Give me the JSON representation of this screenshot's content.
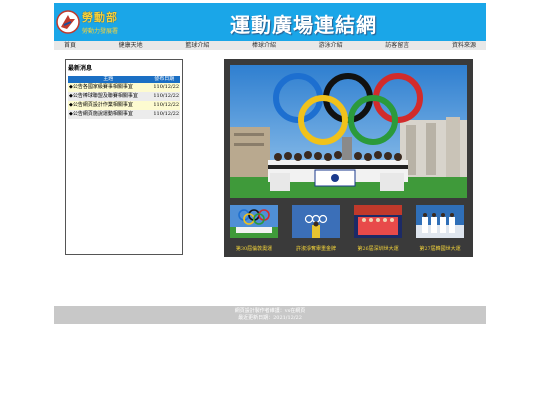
{
  "header": {
    "logo_text": "勞動部",
    "logo_sub": "勞動力發展署",
    "site_title": "運動廣場連結網"
  },
  "nav": {
    "items": [
      "首頁",
      "健康天地",
      "籃球介紹",
      "棒球介紹",
      "游泳介紹",
      "訪客留言",
      "資料來源"
    ]
  },
  "news": {
    "title": "最新消息",
    "col_subject": "主題",
    "col_date": "發布日期",
    "rows": [
      {
        "subject": "◆公告各國家級賽事相關事宜",
        "date": "110/12/22"
      },
      {
        "subject": "◆公告棒球聯盟及聯賽相關事宜",
        "date": "110/12/22"
      },
      {
        "subject": "◆公告網頁設計作業相關事宜",
        "date": "110/12/22"
      },
      {
        "subject": "◆公告網頁施說運動相關事宜",
        "date": "110/12/22"
      }
    ]
  },
  "gallery": {
    "thumbs": [
      {
        "caption": "第30屆倫敦奧運"
      },
      {
        "caption": "許淑淨奪舉重金牌"
      },
      {
        "caption": "第26屆深圳世大運"
      },
      {
        "caption": "第27屆韓國世大運"
      }
    ]
  },
  "footer": {
    "line1": "網頁設計製作者維護：vs在網頁",
    "line2": "最近更新日期：2021/12/22"
  },
  "colors": {
    "header_bg": "#1aa6e8",
    "news_header_bg": "#1b6fc4",
    "gallery_bg": "#3a3a3a",
    "caption": "#f5d53a",
    "footer_bg": "#c8c8c8"
  }
}
